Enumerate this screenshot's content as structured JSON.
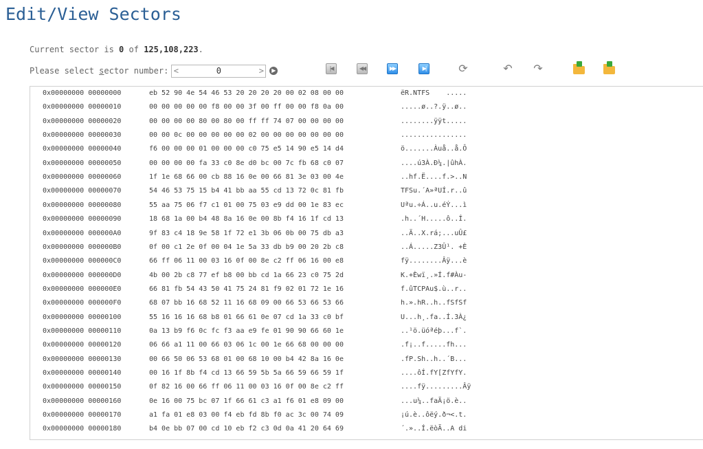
{
  "title": "Edit/View Sectors",
  "status": {
    "prefix": "Current sector is ",
    "current": "0",
    "middle": " of ",
    "total": "125,108,223",
    "suffix": "."
  },
  "selector": {
    "label_before": "Please select ",
    "label_underline": "s",
    "label_after": "ector number:",
    "prev_glyph": "<",
    "next_glyph": ">",
    "value": "0"
  },
  "toolbar": [
    {
      "name": "first-sector-button",
      "icon": "first-sector-icon",
      "glyph": "|◀",
      "style": "grey"
    },
    {
      "name": "previous-sector-button",
      "icon": "previous-sector-icon",
      "glyph": "◀◀",
      "style": "grey"
    },
    {
      "name": "next-sector-button",
      "icon": "next-sector-icon",
      "glyph": "▶▶",
      "style": "blue"
    },
    {
      "name": "last-sector-button",
      "icon": "last-sector-icon",
      "glyph": "▶|",
      "style": "blue"
    },
    {
      "name": "refresh-button",
      "icon": "refresh-icon",
      "glyph": "⟳",
      "style": "plain"
    },
    {
      "name": "undo-button",
      "icon": "undo-icon",
      "glyph": "↶",
      "style": "plain"
    },
    {
      "name": "redo-button",
      "icon": "redo-icon",
      "glyph": "↷",
      "style": "plain"
    },
    {
      "name": "load-sector-button",
      "icon": "folder-down-icon",
      "glyph": "",
      "style": "folder"
    },
    {
      "name": "save-sector-button",
      "icon": "folder-up-icon",
      "glyph": "",
      "style": "folder"
    }
  ],
  "colors": {
    "title": "#2b5f95",
    "text": "#3f3f3f",
    "nav_blue": "#2f8ee8",
    "folder": "#f3b73c",
    "folder_arrow": "#3aa83a"
  },
  "hex_rows": [
    {
      "addr": "0x00000000 00000000",
      "bytes": "eb 52 90 4e 54 46 53 20 20 20 20 00 02 08 00 00",
      "ascii": "ëR.NTFS    ....."
    },
    {
      "addr": "0x00000000 00000010",
      "bytes": "00 00 00 00 00 f8 00 00 3f 00 ff 00 00 f8 0a 00",
      "ascii": ".....ø..?.ÿ..ø.."
    },
    {
      "addr": "0x00000000 00000020",
      "bytes": "00 00 00 00 80 00 80 00 ff ff 74 07 00 00 00 00",
      "ascii": "........ÿÿt....."
    },
    {
      "addr": "0x00000000 00000030",
      "bytes": "00 00 0c 00 00 00 00 00 02 00 00 00 00 00 00 00",
      "ascii": "................"
    },
    {
      "addr": "0x00000000 00000040",
      "bytes": "f6 00 00 00 01 00 00 00 c0 75 e5 14 90 e5 14 d4",
      "ascii": "ö.......Àuå..å.Ô"
    },
    {
      "addr": "0x00000000 00000050",
      "bytes": "00 00 00 00 fa 33 c0 8e d0 bc 00 7c fb 68 c0 07",
      "ascii": "....ú3À.Ð¼.|ûhÀ."
    },
    {
      "addr": "0x00000000 00000060",
      "bytes": "1f 1e 68 66 00 cb 88 16 0e 00 66 81 3e 03 00 4e",
      "ascii": "..hf.Ë....f.>..N"
    },
    {
      "addr": "0x00000000 00000070",
      "bytes": "54 46 53 75 15 b4 41 bb aa 55 cd 13 72 0c 81 fb",
      "ascii": "TFSu.´A»ªUÍ.r..û"
    },
    {
      "addr": "0x00000000 00000080",
      "bytes": "55 aa 75 06 f7 c1 01 00 75 03 e9 dd 00 1e 83 ec",
      "ascii": "Uªu.÷Á..u.éÝ...ì"
    },
    {
      "addr": "0x00000000 00000090",
      "bytes": "18 68 1a 00 b4 48 8a 16 0e 00 8b f4 16 1f cd 13",
      "ascii": ".h..´H.....ô..Í."
    },
    {
      "addr": "0x00000000 000000A0",
      "bytes": "9f 83 c4 18 9e 58 1f 72 e1 3b 06 0b 00 75 db a3",
      "ascii": "..Ä..X.rá;...uÛ£"
    },
    {
      "addr": "0x00000000 000000B0",
      "bytes": "0f 00 c1 2e 0f 00 04 1e 5a 33 db b9 00 20 2b c8",
      "ascii": "..Á.....Z3Û¹. +È"
    },
    {
      "addr": "0x00000000 000000C0",
      "bytes": "66 ff 06 11 00 03 16 0f 00 8e c2 ff 06 16 00 e8",
      "ascii": "fÿ........Âÿ...è"
    },
    {
      "addr": "0x00000000 000000D0",
      "bytes": "4b 00 2b c8 77 ef b8 00 bb cd 1a 66 23 c0 75 2d",
      "ascii": "K.+Èwï¸.»Í.f#Àu-"
    },
    {
      "addr": "0x00000000 000000E0",
      "bytes": "66 81 fb 54 43 50 41 75 24 81 f9 02 01 72 1e 16",
      "ascii": "f.ûTCPAu$.ù..r.."
    },
    {
      "addr": "0x00000000 000000F0",
      "bytes": "68 07 bb 16 68 52 11 16 68 09 00 66 53 66 53 66",
      "ascii": "h.».hR..h..fSfSf"
    },
    {
      "addr": "0x00000000 00000100",
      "bytes": "55 16 16 16 68 b8 01 66 61 0e 07 cd 1a 33 c0 bf",
      "ascii": "U...h¸.fa..Í.3À¿"
    },
    {
      "addr": "0x00000000 00000110",
      "bytes": "0a 13 b9 f6 0c fc f3 aa e9 fe 01 90 90 66 60 1e",
      "ascii": "..¹ö.üóªéþ...f`."
    },
    {
      "addr": "0x00000000 00000120",
      "bytes": "06 66 a1 11 00 66 03 06 1c 00 1e 66 68 00 00 00",
      "ascii": ".f¡..f.....fh..."
    },
    {
      "addr": "0x00000000 00000130",
      "bytes": "00 66 50 06 53 68 01 00 68 10 00 b4 42 8a 16 0e",
      "ascii": ".fP.Sh..h..´B..."
    },
    {
      "addr": "0x00000000 00000140",
      "bytes": "00 16 1f 8b f4 cd 13 66 59 5b 5a 66 59 66 59 1f",
      "ascii": "....ôÍ.fY[ZfYfY."
    },
    {
      "addr": "0x00000000 00000150",
      "bytes": "0f 82 16 00 66 ff 06 11 00 03 16 0f 00 8e c2 ff",
      "ascii": "....fÿ.........Âÿ"
    },
    {
      "addr": "0x00000000 00000160",
      "bytes": "0e 16 00 75 bc 07 1f 66 61 c3 a1 f6 01 e8 09 00",
      "ascii": "...u¼..faÃ¡ö.è.."
    },
    {
      "addr": "0x00000000 00000170",
      "bytes": "a1 fa 01 e8 03 00 f4 eb fd 8b f0 ac 3c 00 74 09",
      "ascii": "¡ú.è..ôëý.ð¬<.t."
    },
    {
      "addr": "0x00000000 00000180",
      "bytes": "b4 0e bb 07 00 cd 10 eb f2 c3 0d 0a 41 20 64 69",
      "ascii": "´.»..Í.ëòÃ..A di"
    }
  ]
}
